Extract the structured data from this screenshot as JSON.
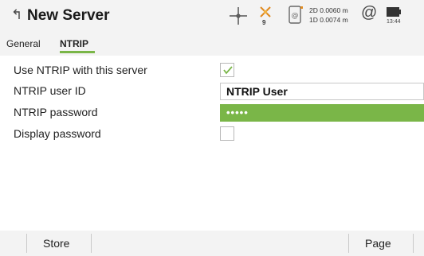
{
  "header": {
    "title": "New Server",
    "satellite_count": "9",
    "precision_2d": "2D 0.0060 m",
    "precision_1d": "1D 0.0074 m",
    "at_symbol": "@",
    "time": "13:44",
    "icons": [
      "back-icon",
      "crosshair-icon",
      "satellite-icon",
      "device-icon",
      "at-icon",
      "battery-icon"
    ]
  },
  "tabs": [
    {
      "label": "General",
      "active": false
    },
    {
      "label": "NTRIP",
      "active": true
    }
  ],
  "form": {
    "use_ntrip": {
      "label": "Use NTRIP with this server",
      "checked": true
    },
    "user_id": {
      "label": "NTRIP user ID",
      "value": "NTRIP User"
    },
    "password": {
      "label": "NTRIP password",
      "value": "•••••"
    },
    "display_password": {
      "label": "Display password",
      "checked": false
    }
  },
  "softkeys": {
    "store": "Store",
    "page": "Page"
  },
  "colors": {
    "accent": "#7ab648",
    "bar_background": "#f3f3f3"
  }
}
